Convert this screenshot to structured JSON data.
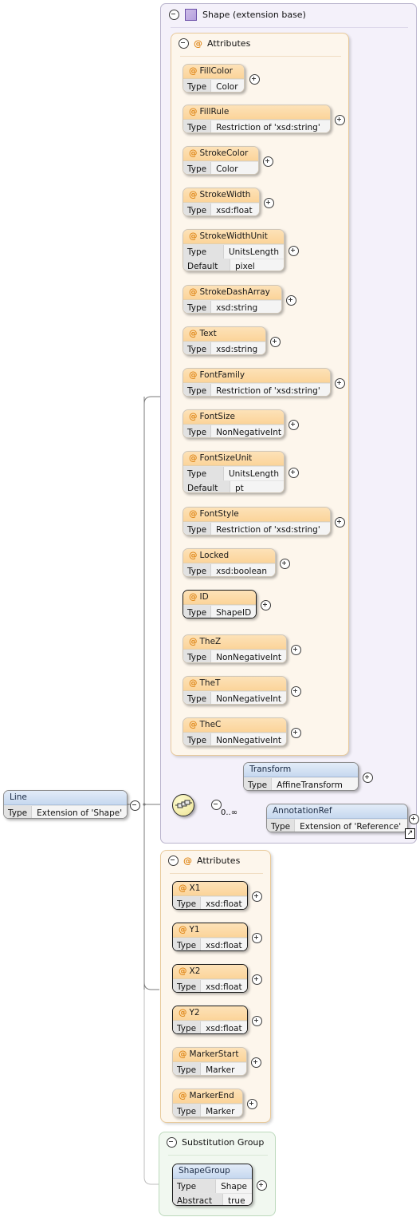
{
  "diagram": {
    "type": "xsd-schema-diagram",
    "root_element": {
      "name": "Line",
      "rows": [
        {
          "key": "Type",
          "value": "Extension of 'Shape'"
        }
      ],
      "collapse_icon": "minus-circle-icon"
    },
    "extension_base": {
      "label": "Shape (extension base)",
      "icon": "purple-square-icon",
      "collapse_icon": "minus-circle-icon",
      "attributes_group": {
        "label": "Attributes",
        "icon": "at-icon",
        "collapse_icon": "minus-circle-icon",
        "items": [
          {
            "name": "FillColor",
            "required": false,
            "rows": [
              {
                "key": "Type",
                "value": "Color"
              }
            ]
          },
          {
            "name": "FillRule",
            "required": false,
            "rows": [
              {
                "key": "Type",
                "value": "Restriction of 'xsd:string'"
              }
            ]
          },
          {
            "name": "StrokeColor",
            "required": false,
            "rows": [
              {
                "key": "Type",
                "value": "Color"
              }
            ]
          },
          {
            "name": "StrokeWidth",
            "required": false,
            "rows": [
              {
                "key": "Type",
                "value": "xsd:float"
              }
            ]
          },
          {
            "name": "StrokeWidthUnit",
            "required": false,
            "rows": [
              {
                "key": "Type",
                "value": "UnitsLength"
              },
              {
                "key": "Default",
                "value": "pixel"
              }
            ]
          },
          {
            "name": "StrokeDashArray",
            "required": false,
            "rows": [
              {
                "key": "Type",
                "value": "xsd:string"
              }
            ]
          },
          {
            "name": "Text",
            "required": false,
            "rows": [
              {
                "key": "Type",
                "value": "xsd:string"
              }
            ]
          },
          {
            "name": "FontFamily",
            "required": false,
            "rows": [
              {
                "key": "Type",
                "value": "Restriction of 'xsd:string'"
              }
            ]
          },
          {
            "name": "FontSize",
            "required": false,
            "rows": [
              {
                "key": "Type",
                "value": "NonNegativeInt"
              }
            ]
          },
          {
            "name": "FontSizeUnit",
            "required": false,
            "rows": [
              {
                "key": "Type",
                "value": "UnitsLength"
              },
              {
                "key": "Default",
                "value": "pt"
              }
            ]
          },
          {
            "name": "FontStyle",
            "required": false,
            "rows": [
              {
                "key": "Type",
                "value": "Restriction of 'xsd:string'"
              }
            ]
          },
          {
            "name": "Locked",
            "required": false,
            "rows": [
              {
                "key": "Type",
                "value": "xsd:boolean"
              }
            ]
          },
          {
            "name": "ID",
            "required": true,
            "rows": [
              {
                "key": "Type",
                "value": "ShapeID"
              }
            ]
          },
          {
            "name": "TheZ",
            "required": false,
            "rows": [
              {
                "key": "Type",
                "value": "NonNegativeInt"
              }
            ]
          },
          {
            "name": "TheT",
            "required": false,
            "rows": [
              {
                "key": "Type",
                "value": "NonNegativeInt"
              }
            ]
          },
          {
            "name": "TheC",
            "required": false,
            "rows": [
              {
                "key": "Type",
                "value": "NonNegativeInt"
              }
            ]
          }
        ]
      },
      "sequence": {
        "icon": "sequence-compositor-icon",
        "collapse_icon": "minus-circle-icon",
        "children": [
          {
            "name": "Transform",
            "cardinality": "",
            "external": false,
            "rows": [
              {
                "key": "Type",
                "value": "AffineTransform"
              }
            ]
          },
          {
            "name": "AnnotationRef",
            "cardinality": "0..∞",
            "external": true,
            "rows": [
              {
                "key": "Type",
                "value": "Extension of 'Reference'"
              }
            ]
          }
        ]
      }
    },
    "line_attributes_group": {
      "label": "Attributes",
      "icon": "at-icon",
      "collapse_icon": "minus-circle-icon",
      "items": [
        {
          "name": "X1",
          "required": true,
          "rows": [
            {
              "key": "Type",
              "value": "xsd:float"
            }
          ]
        },
        {
          "name": "Y1",
          "required": true,
          "rows": [
            {
              "key": "Type",
              "value": "xsd:float"
            }
          ]
        },
        {
          "name": "X2",
          "required": true,
          "rows": [
            {
              "key": "Type",
              "value": "xsd:float"
            }
          ]
        },
        {
          "name": "Y2",
          "required": true,
          "rows": [
            {
              "key": "Type",
              "value": "xsd:float"
            }
          ]
        },
        {
          "name": "MarkerStart",
          "required": false,
          "rows": [
            {
              "key": "Type",
              "value": "Marker"
            }
          ]
        },
        {
          "name": "MarkerEnd",
          "required": false,
          "rows": [
            {
              "key": "Type",
              "value": "Marker"
            }
          ]
        }
      ]
    },
    "substitution_group": {
      "label": "Substitution Group",
      "collapse_icon": "minus-circle-icon",
      "items": [
        {
          "name": "ShapeGroup",
          "rows": [
            {
              "key": "Type",
              "value": "Shape"
            },
            {
              "key": "Abstract",
              "value": "true"
            }
          ]
        }
      ]
    },
    "colors": {
      "attr_header": "#fbd49a",
      "elem_header": "#c6d8ef",
      "panel_bg": "#f4f1fa",
      "attr_panel_bg": "#fdf6ec",
      "sub_panel_bg": "#f1f8f0",
      "connector": "#7a7a7a"
    }
  }
}
